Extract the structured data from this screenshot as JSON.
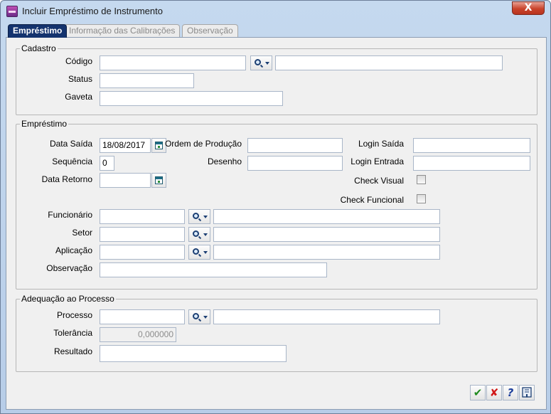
{
  "window": {
    "title": "Incluir Empréstimo de Instrumento",
    "close_label": "X"
  },
  "tabs": [
    {
      "label": "Empréstimo",
      "active": true
    },
    {
      "label": "Informação das Calibrações",
      "active": false
    },
    {
      "label": "Observação",
      "active": false
    }
  ],
  "cadastro": {
    "legend": "Cadastro",
    "codigo_label": "Código",
    "codigo_value": "",
    "codigo_desc": "",
    "status_label": "Status",
    "status_value": "",
    "gaveta_label": "Gaveta",
    "gaveta_value": ""
  },
  "emprestimo": {
    "legend": "Empréstimo",
    "data_saida_label": "Data Saída",
    "data_saida_value": "18/08/2017",
    "sequencia_label": "Sequência",
    "sequencia_value": "0",
    "data_retorno_label": "Data Retorno",
    "data_retorno_value": "",
    "ordem_label": "Ordem de Produção",
    "ordem_value": "",
    "desenho_label": "Desenho",
    "desenho_value": "",
    "login_saida_label": "Login Saída",
    "login_saida_value": "",
    "login_entrada_label": "Login Entrada",
    "login_entrada_value": "",
    "check_visual_label": "Check Visual",
    "check_visual_checked": false,
    "check_funcional_label": "Check Funcional",
    "check_funcional_checked": false,
    "funcionario_label": "Funcionário",
    "funcionario_value": "",
    "funcionario_desc": "",
    "setor_label": "Setor",
    "setor_value": "",
    "setor_desc": "",
    "aplicacao_label": "Aplicação",
    "aplicacao_value": "",
    "aplicacao_desc": "",
    "observacao_label": "Observação",
    "observacao_value": ""
  },
  "adequacao": {
    "legend": "Adequação ao Processo",
    "processo_label": "Processo",
    "processo_value": "",
    "processo_desc": "",
    "tolerancia_label": "Tolerância",
    "tolerancia_value": "0,000000",
    "resultado_label": "Resultado",
    "resultado_value": ""
  },
  "actions": {
    "ok_glyph": "✔",
    "cancel_glyph": "✘",
    "help_glyph": "?"
  },
  "colors": {
    "active_tab": "#14336e",
    "ok": "#1e8a1e",
    "cancel": "#d11a1a",
    "help": "#1c3f9c"
  }
}
